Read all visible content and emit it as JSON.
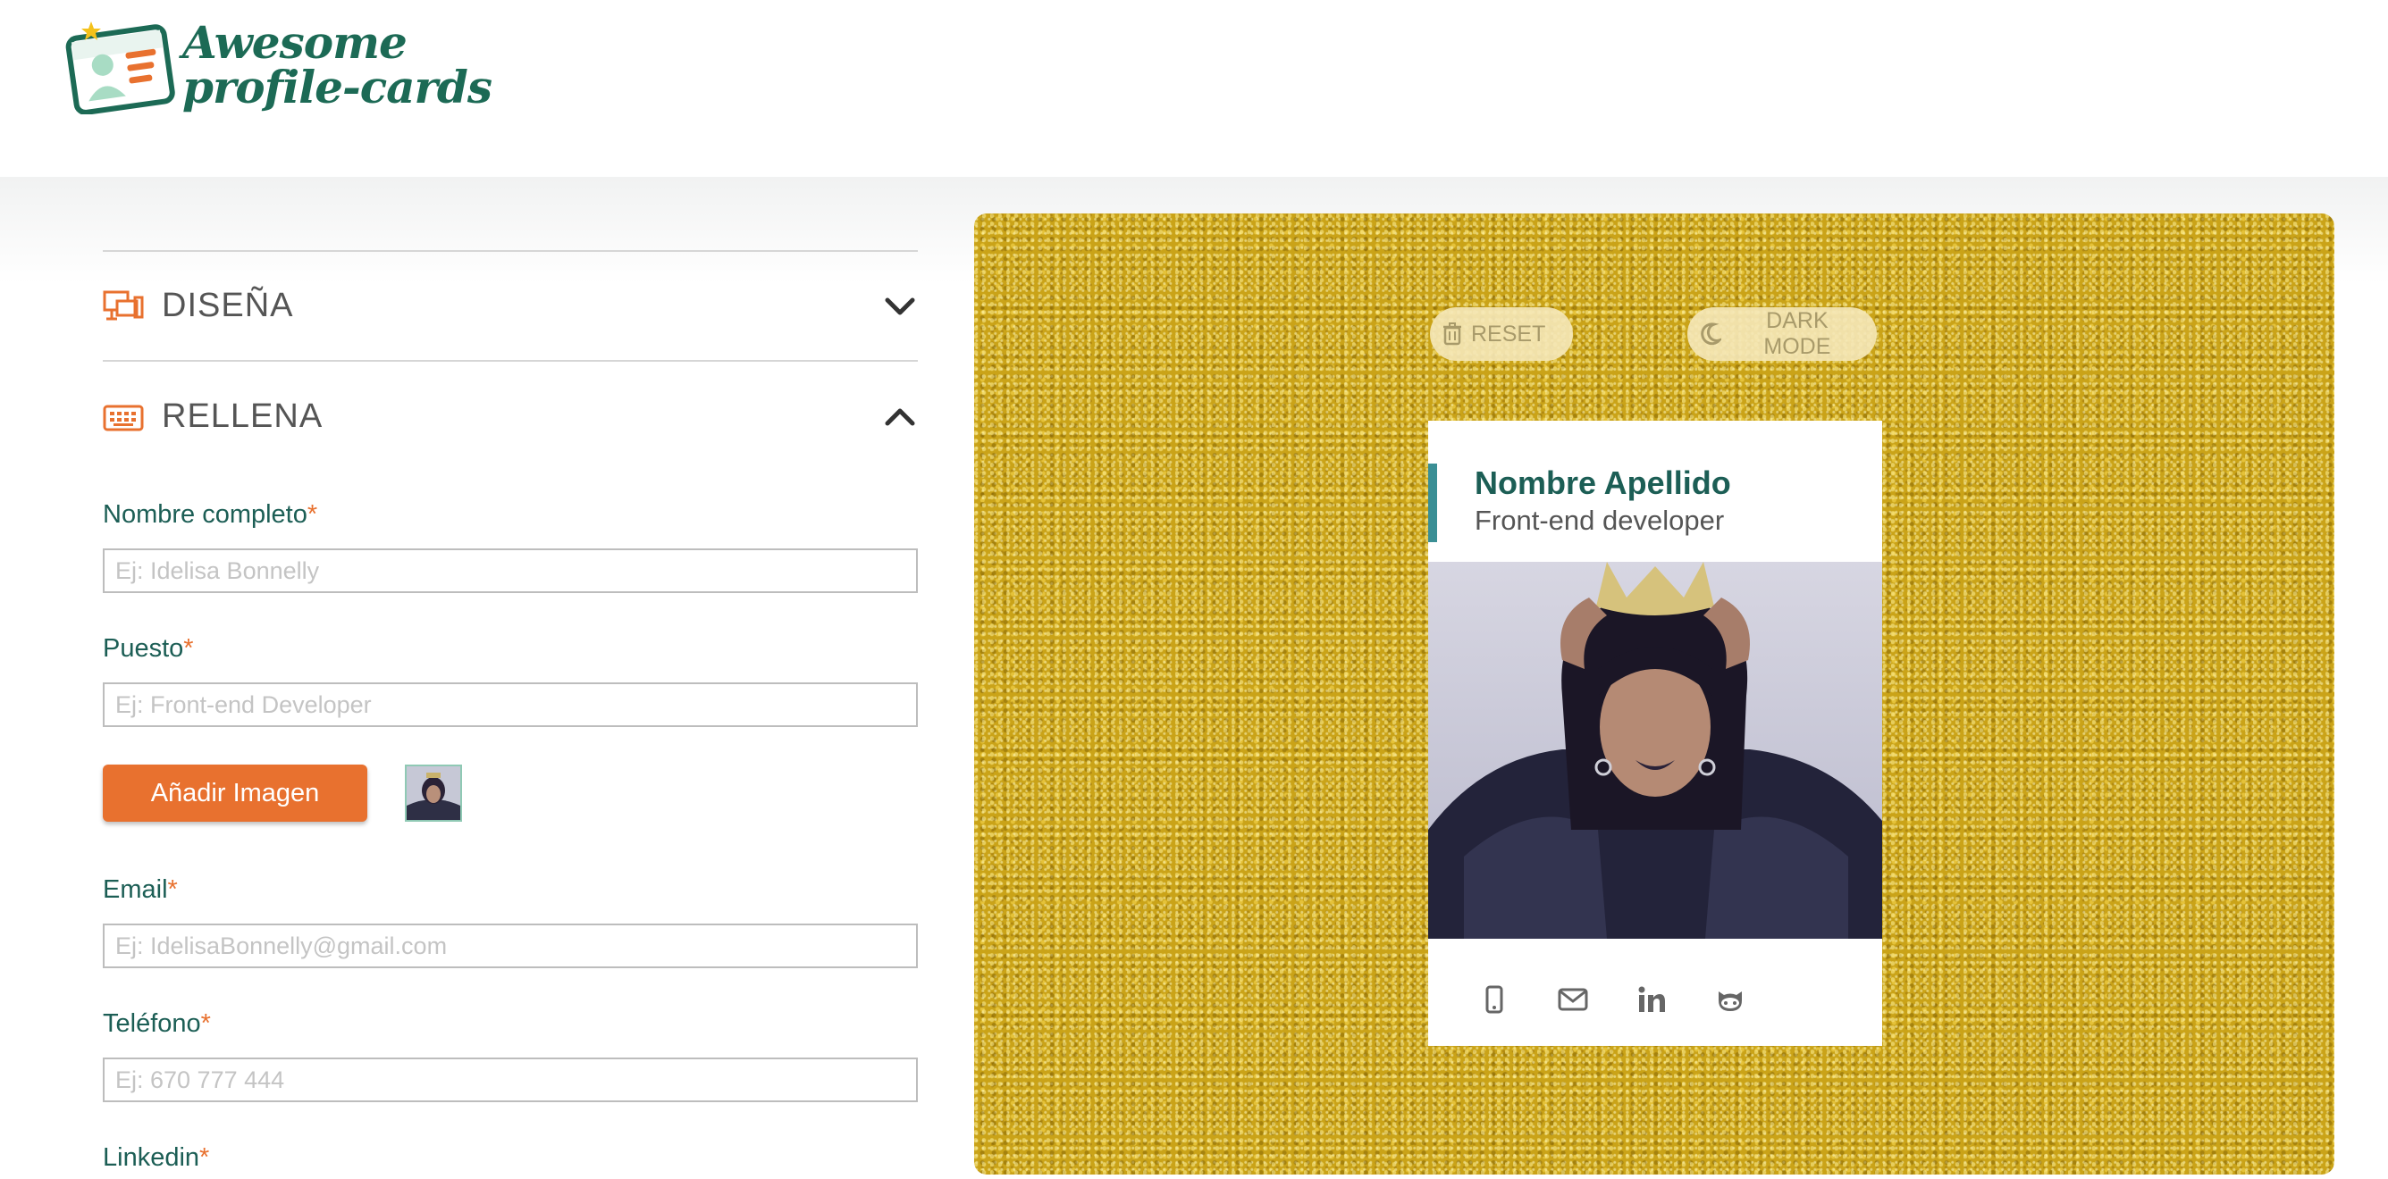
{
  "header": {
    "logo_line1": "Awesome",
    "logo_line2": "profile-cards"
  },
  "sections": [
    {
      "title": "DISEÑA",
      "icon": "design-icon",
      "expanded": false
    },
    {
      "title": "RELLENA",
      "icon": "keyboard-icon",
      "expanded": true
    }
  ],
  "form": {
    "name": {
      "label": "Nombre completo",
      "required": "*",
      "placeholder": "Ej: Idelisa Bonnelly",
      "value": ""
    },
    "job": {
      "label": "Puesto",
      "required": "*",
      "placeholder": "Ej: Front-end Developer",
      "value": ""
    },
    "add_image_label": "Añadir Imagen",
    "email": {
      "label": "Email",
      "required": "*",
      "placeholder": "Ej: IdelisaBonnelly@gmail.com",
      "value": ""
    },
    "phone": {
      "label": "Teléfono",
      "required": "*",
      "placeholder": "Ej: 670 777 444",
      "value": ""
    },
    "linkedin": {
      "label": "Linkedin",
      "required": "*"
    }
  },
  "preview": {
    "reset_label": "RESET",
    "dark_mode_label": "DARK MODE",
    "card": {
      "name": "Nombre Apellido",
      "job": "Front-end developer",
      "social_icons": [
        "mobile-icon",
        "mail-icon",
        "linkedin-icon",
        "github-icon"
      ]
    }
  },
  "colors": {
    "accent_orange": "#e8712f",
    "brand_green": "#1c5e55",
    "card_accent": "#3b8f95",
    "glitter_gold": "#caa318"
  }
}
